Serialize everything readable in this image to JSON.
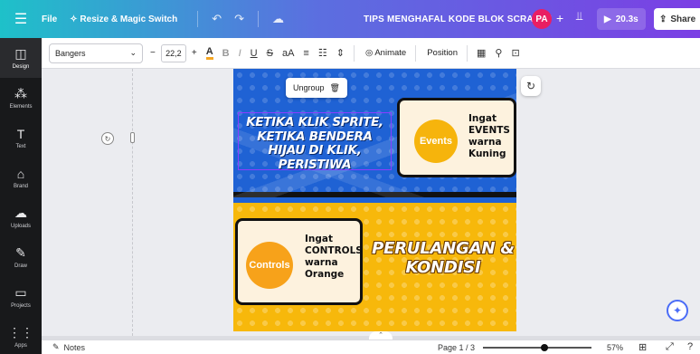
{
  "topbar": {
    "menu_icon": "hamburger-icon",
    "file": "File",
    "resize": "Resize & Magic Switch",
    "title": "TIPS MENGHAFAL KODE BLOK SCRATCH",
    "avatar": "PA",
    "play_label": "20.3s",
    "share": "Share"
  },
  "rail": [
    {
      "label": "Design",
      "icon": "layout-icon",
      "glyph": "◫"
    },
    {
      "label": "Elements",
      "icon": "shapes-icon",
      "glyph": "⁂"
    },
    {
      "label": "Text",
      "icon": "text-icon",
      "glyph": "T"
    },
    {
      "label": "Brand",
      "icon": "brand-icon",
      "glyph": "⌂"
    },
    {
      "label": "Uploads",
      "icon": "upload-icon",
      "glyph": "☁"
    },
    {
      "label": "Draw",
      "icon": "pen-icon",
      "glyph": "✎"
    },
    {
      "label": "Projects",
      "icon": "folder-icon",
      "glyph": "▭"
    },
    {
      "label": "Apps",
      "icon": "apps-icon",
      "glyph": "⋮⋮"
    }
  ],
  "toolbar": {
    "font": "Bangers",
    "font_size": "22,2",
    "animate": "Animate",
    "position": "Position"
  },
  "canvas": {
    "ungroup": "Ungroup",
    "heading_top": "KETIKA KLIK SPRITE, KETIKA BENDERA HIJAU DI KLIK, PERISTIWA",
    "events_badge": "Events",
    "events_lines": [
      "Ingat",
      "EVENTS",
      "warna",
      "Kuning"
    ],
    "controls_badge": "Controls",
    "controls_lines": [
      "Ingat",
      "CONTROLS",
      "warna",
      "Orange"
    ],
    "heading_bottom": "PERULANGAN & KONDISI"
  },
  "footer": {
    "notes": "Notes",
    "page": "Page 1 / 3",
    "zoom_level": 0.57,
    "zoom": "57%"
  },
  "colors": {
    "accent": "#8b3dff",
    "canvas_blue": "#1f62d4",
    "canvas_yellow": "#f7b80b"
  }
}
